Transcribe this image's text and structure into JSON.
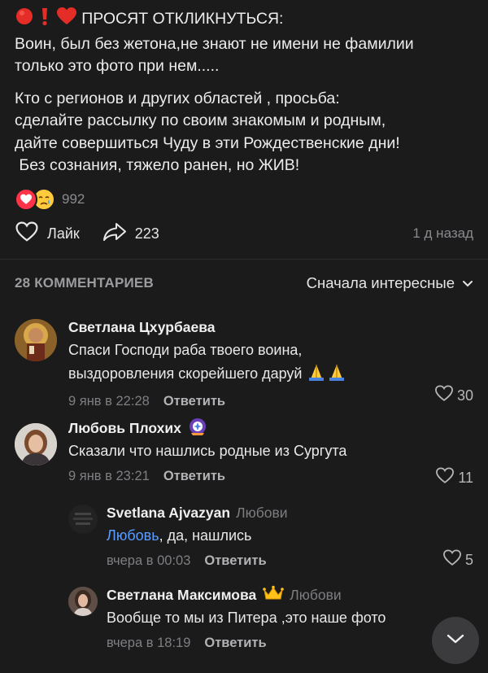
{
  "post": {
    "headline": "ПРОСЯТ ОТКЛИКНУТЬСЯ:",
    "line1": "Воин, был без жетона,не знают не имени не фамилии",
    "line2": "только это фото при нем.....",
    "line3": "Кто с регионов и других областей , просьба:",
    "line4": "сделайте рассылку по своим знакомым и родным,",
    "line5": "дайте совершиться Чуду в эти Рождественские дни!",
    "line6": " Без сознания, тяжело ранен, но ЖИВ!",
    "reactions_count": "992",
    "like_label": "Лайк",
    "share_count": "223",
    "time_ago": "1 д назад"
  },
  "comments_header": {
    "count_label": "28 КОММЕНТАРИЕВ",
    "sort_label": "Сначала интересные"
  },
  "comments": [
    {
      "author": "Светлана Цхурбаева",
      "text_line1": "Спаси Господи раба твоего воина,",
      "text_line2": "выздоровления скорейшего даруй",
      "time": "9 янв в 22:28",
      "reply_label": "Ответить",
      "likes": "30"
    },
    {
      "author": "Любовь Плохих",
      "text": "Сказали что нашлись родные из Сургута",
      "time": "9 янв в 23:21",
      "reply_label": "Ответить",
      "likes": "11"
    },
    {
      "author": "Svetlana Ajvazyan",
      "reply_to": "Любови",
      "mention": "Любовь",
      "text": ", да, нашлись",
      "time": "вчера в 00:03",
      "reply_label": "Ответить",
      "likes": "5"
    },
    {
      "author": "Светлана Максимова",
      "reply_to": "Любови",
      "text": "Вообще то мы из Питера ,это наше фото",
      "time": "вчера в 18:19",
      "reply_label": "Ответить"
    }
  ],
  "colors": {
    "background": "#1b1b1c",
    "accent_red": "#ff3347",
    "mention_blue": "#5b9cff",
    "muted": "#7f7f83"
  },
  "icons": [
    "red-circle-icon",
    "exclamation-icon",
    "heart-icon",
    "crying-face-icon",
    "like-heart-icon",
    "share-arrow-icon",
    "chevron-down-icon",
    "praying-hands-icon",
    "crown-icon",
    "badge-icon"
  ]
}
